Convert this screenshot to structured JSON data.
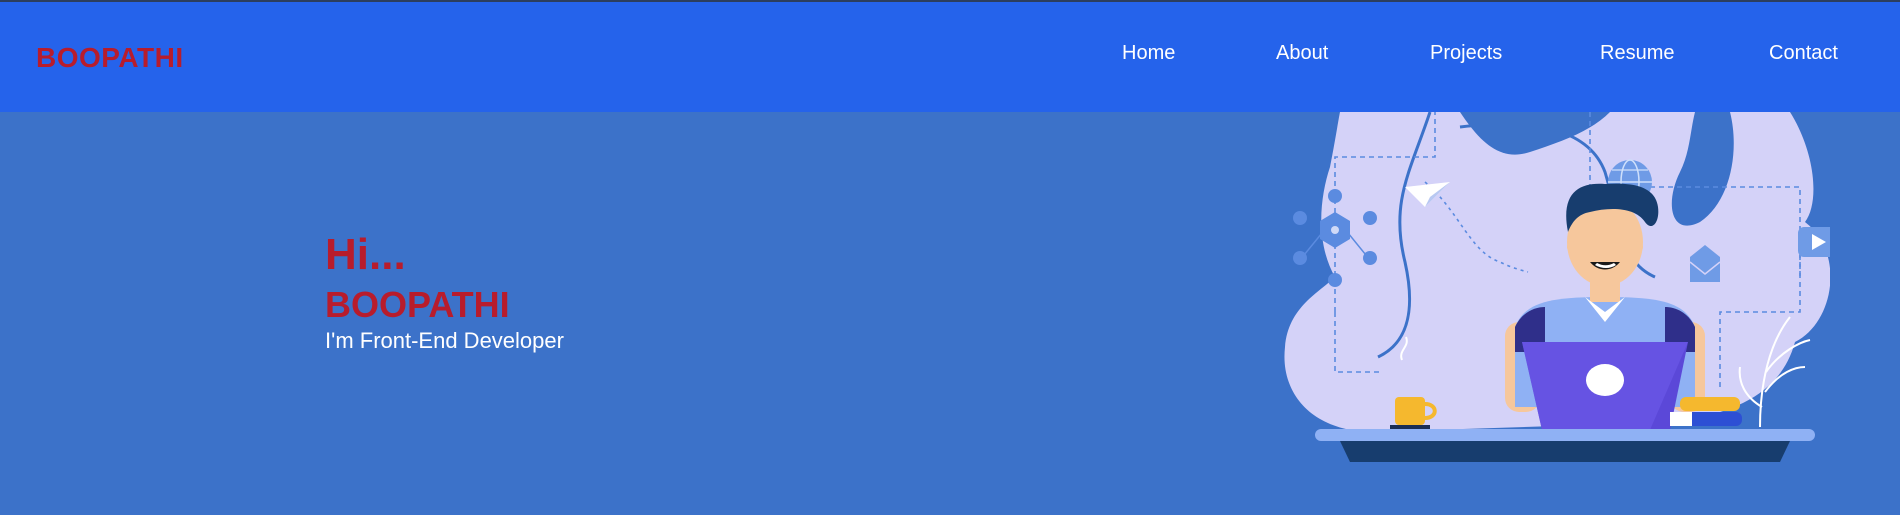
{
  "brand": {
    "name": "BOOPATHI"
  },
  "nav": {
    "items": [
      {
        "label": "Home"
      },
      {
        "label": "About"
      },
      {
        "label": "Projects"
      },
      {
        "label": "Resume"
      },
      {
        "label": "Contact"
      }
    ]
  },
  "hero": {
    "greeting": "Hi...",
    "name": "BOOPATHI",
    "role": "I'm Front-End Developer"
  },
  "colors": {
    "navbar_bg": "#2563eb",
    "page_bg": "#3c72c9",
    "accent_red": "#b81c2c",
    "illustration_bg": "#d4d2f8",
    "laptop": "#5b48d8"
  }
}
